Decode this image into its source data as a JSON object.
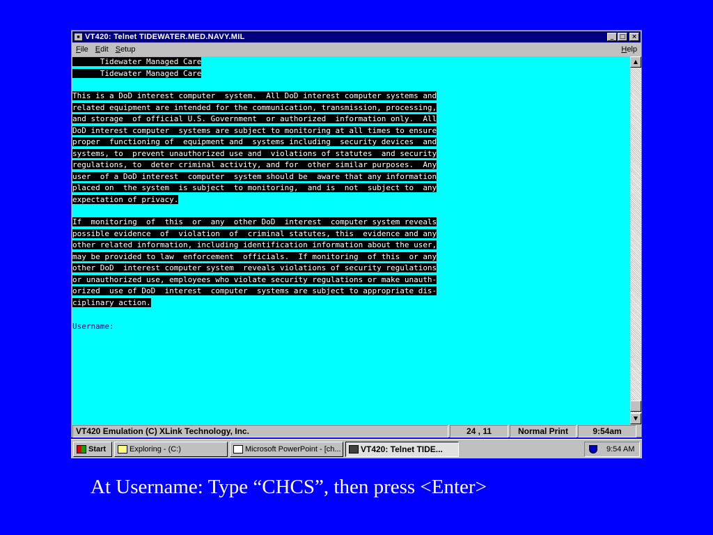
{
  "window": {
    "title": "VT420: Telnet TIDEWATER.MED.NAVY.MIL",
    "minimize": "_",
    "maximize": "□",
    "close": "×"
  },
  "menu": {
    "file": {
      "accel": "F",
      "rest": "ile"
    },
    "edit": {
      "accel": "E",
      "rest": "dit"
    },
    "setup": {
      "accel": "S",
      "rest": "etup"
    },
    "help": {
      "accel": "H",
      "rest": "elp"
    }
  },
  "terminal": {
    "header": [
      "      Tidewater Managed Care",
      "      Tidewater Managed Care"
    ],
    "paragraph1": [
      "This is a DoD interest computer  system.  All DoD interest computer systems and",
      "related equipment are intended for the communication, transmission, processing,",
      "and storage  of official U.S. Government  or authorized  information only.  All",
      "DoD interest computer  systems are subject to monitoring at all times to ensure",
      "proper  functioning of  equipment and  systems including  security devices  and",
      "systems, to  prevent unauthorized use and  violations of statutes  and security",
      "regulations, to  deter criminal activity, and for  other similar purposes.  Any",
      "user  of a DoD interest  computer  system should be  aware that any information",
      "placed on  the system  is subject  to monitoring,  and is  not  subject to  any",
      "expectation of privacy."
    ],
    "paragraph2": [
      "If  monitoring  of  this  or  any  other DoD  interest  computer system reveals",
      "possible evidence  of  violation  of  criminal statutes, this  evidence and any",
      "other related information, including identification information about the user,",
      "may be provided to law  enforcement  officials.  If monitoring  of this  or any",
      "other DoD  interest computer system  reveals violations of security regulations",
      "or unauthorized use, employees who violate security regulations or make unauth-",
      "orized  use of DoD  interest  computer  systems are subject to appropriate dis-",
      "ciplinary action."
    ],
    "prompt": "Username:"
  },
  "status": {
    "emulation": "VT420 Emulation (C) XLink Technology, Inc.",
    "position": "24 , 11",
    "mode": "Normal Print",
    "time": "9:54am"
  },
  "taskbar": {
    "start": "Start",
    "tasks": [
      "Exploring - (C:)",
      "Microsoft PowerPoint - [ch...",
      "VT420: Telnet TIDE..."
    ],
    "clock": "9:54 AM"
  },
  "caption": "At Username: Type “CHCS”, then press <Enter>"
}
